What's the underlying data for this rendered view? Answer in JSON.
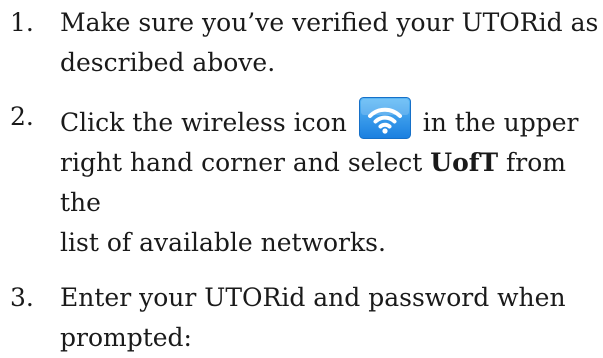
{
  "steps": [
    {
      "number": "1.",
      "text_line1": "Make sure you’ve verified your UTORid as",
      "text_line2": "described above."
    },
    {
      "number": "2.",
      "text_before_icon": "Click the wireless icon",
      "icon": "wifi-icon",
      "text_after_icon": "in the upper",
      "text_line2_before_bold": "right hand corner and select ",
      "bold_text": "UofT",
      "text_line2_after_bold": " from the",
      "text_line3": "list of available networks."
    },
    {
      "number": "3.",
      "text_line1": "Enter your UTORid and password when",
      "text_line2": "prompted:"
    }
  ],
  "colors": {
    "text": "#1a1a1a",
    "icon_bg_top": "#5ab8f5",
    "icon_bg_bottom": "#1a7fe0",
    "icon_glyph": "#ffffff"
  }
}
